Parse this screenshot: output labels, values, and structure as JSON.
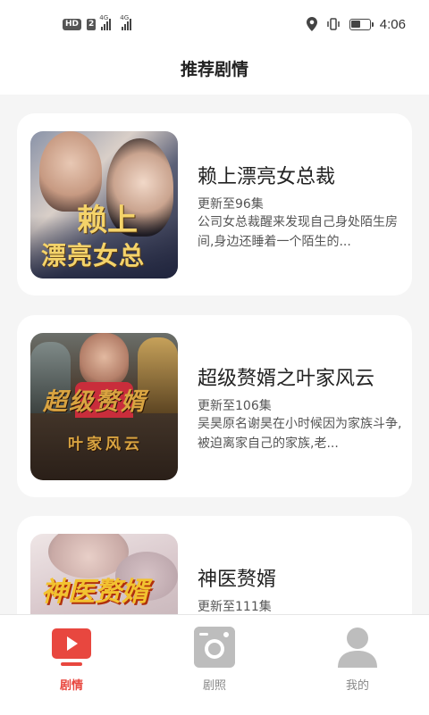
{
  "status_bar": {
    "hd": "HD",
    "sim": "2",
    "net1": "4G",
    "net2": "4G",
    "time": "4:06"
  },
  "header": {
    "title": "推荐剧情"
  },
  "dramas": [
    {
      "title": "赖上漂亮女总裁",
      "episodes": "更新至96集",
      "desc": "公司女总裁醒来发现自己身处陌生房间,身边还睡着一个陌生的...",
      "poster_line1": "赖上",
      "poster_line2": "漂亮女总"
    },
    {
      "title": "超级赘婿之叶家风云",
      "episodes": "更新至106集",
      "desc": "吴昊原名谢昊在小时候因为家族斗争,被迫离家自己的家族,老...",
      "poster_line1": "超级赘婿",
      "poster_line2": "叶家风云"
    },
    {
      "title": "神医赘婿",
      "episodes": "更新至111集",
      "desc": "",
      "poster_line1": "神医赘婿",
      "poster_line2": ""
    }
  ],
  "tabs": [
    {
      "label": "剧情",
      "icon": "play-video-icon",
      "active": true
    },
    {
      "label": "剧照",
      "icon": "camera-icon",
      "active": false
    },
    {
      "label": "我的",
      "icon": "user-icon",
      "active": false
    }
  ],
  "colors": {
    "accent": "#e8473f",
    "inactive_icon": "#bdbdbd",
    "background": "#f5f5f5"
  }
}
